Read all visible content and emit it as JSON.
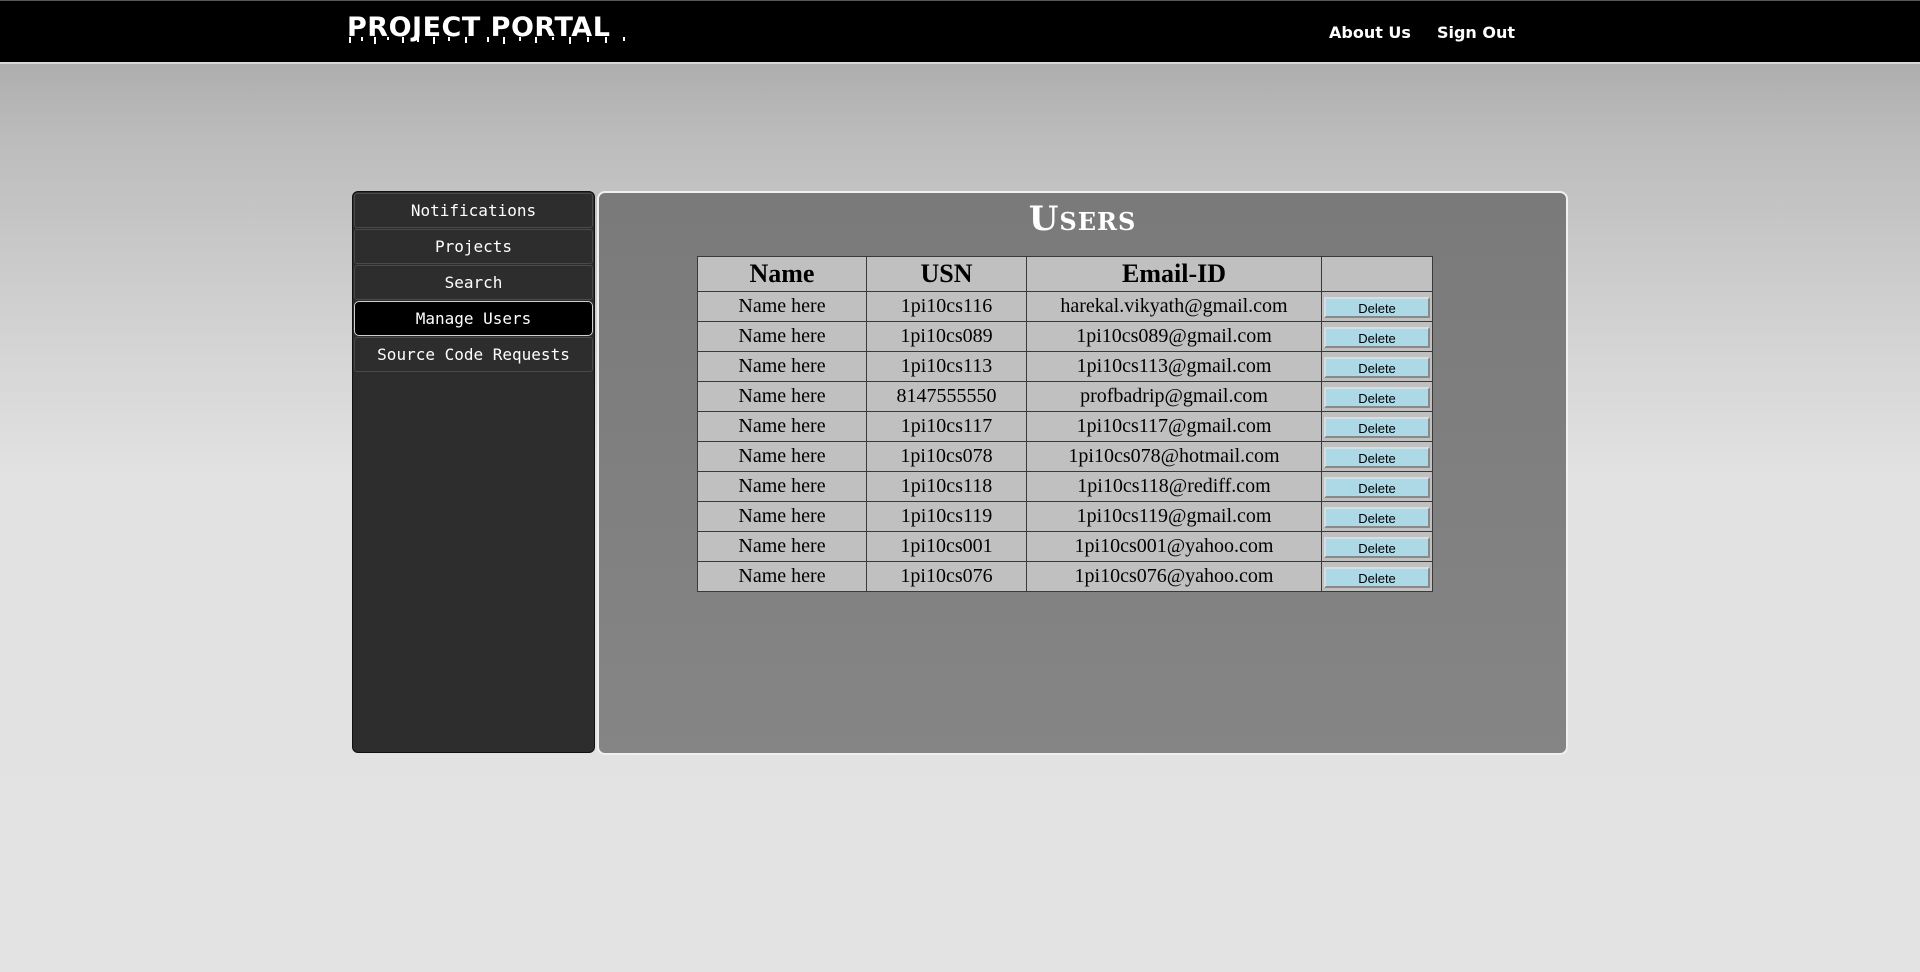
{
  "header": {
    "logo": "PROJECT PORTAL",
    "nav": [
      {
        "label": "About Us"
      },
      {
        "label": "Sign Out"
      }
    ]
  },
  "sidebar": {
    "items": [
      {
        "label": "Notifications",
        "active": false
      },
      {
        "label": "Projects",
        "active": false
      },
      {
        "label": "Search",
        "active": false
      },
      {
        "label": "Manage Users",
        "active": true
      },
      {
        "label": "Source Code Requests",
        "active": false
      }
    ]
  },
  "main": {
    "title": "Users",
    "table": {
      "headers": [
        "Name",
        "USN",
        "Email-ID",
        ""
      ],
      "delete_label": "Delete",
      "rows": [
        {
          "name": "Name here",
          "usn": "1pi10cs116",
          "email": "harekal.vikyath@gmail.com"
        },
        {
          "name": "Name here",
          "usn": "1pi10cs089",
          "email": "1pi10cs089@gmail.com"
        },
        {
          "name": "Name here",
          "usn": "1pi10cs113",
          "email": "1pi10cs113@gmail.com"
        },
        {
          "name": "Name here",
          "usn": "8147555550",
          "email": "profbadrip@gmail.com"
        },
        {
          "name": "Name here",
          "usn": "1pi10cs117",
          "email": "1pi10cs117@gmail.com"
        },
        {
          "name": "Name here",
          "usn": "1pi10cs078",
          "email": "1pi10cs078@hotmail.com"
        },
        {
          "name": "Name here",
          "usn": "1pi10cs118",
          "email": "1pi10cs118@rediff.com"
        },
        {
          "name": "Name here",
          "usn": "1pi10cs119",
          "email": "1pi10cs119@gmail.com"
        },
        {
          "name": "Name here",
          "usn": "1pi10cs001",
          "email": "1pi10cs001@yahoo.com"
        },
        {
          "name": "Name here",
          "usn": "1pi10cs076",
          "email": "1pi10cs076@yahoo.com"
        }
      ]
    }
  },
  "colors": {
    "topbar": "#000000",
    "sidebar": "#2d2d2d",
    "content_panel": "#808080",
    "table_bg": "#c0c0c0",
    "delete_button": "#add8e6"
  }
}
